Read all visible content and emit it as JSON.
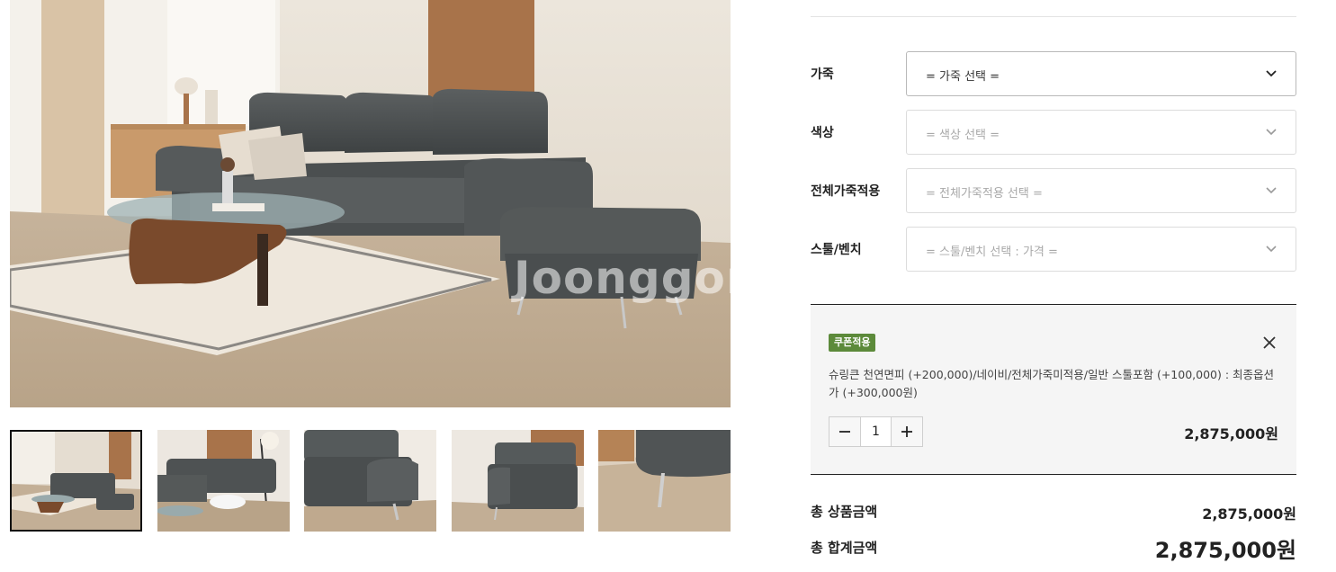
{
  "gallery": {
    "watermark": "Joonggon",
    "thumbnails": [
      {
        "name": "living-room-wide",
        "active": true
      },
      {
        "name": "sofa-with-lamp",
        "active": false
      },
      {
        "name": "sofa-arm-detail",
        "active": false
      },
      {
        "name": "loveseat-view",
        "active": false
      },
      {
        "name": "leg-detail",
        "active": false
      }
    ]
  },
  "options": [
    {
      "label": "가죽",
      "placeholder": "= 가죽 선택 =",
      "active": true
    },
    {
      "label": "색상",
      "placeholder": "= 색상 선택 =",
      "active": false
    },
    {
      "label": "전체가죽적용",
      "placeholder": "= 전체가죽적용 선택 =",
      "active": false
    },
    {
      "label": "스툴/벤치",
      "placeholder": "= 스툴/벤치 선택 : 가격 =",
      "active": false
    }
  ],
  "selected_item": {
    "badge": "쿠폰적용",
    "description": "슈링큰 천연면피 (+200,000)/네이비/전체가죽미적용/일반 스툴포함 (+100,000) : 최종옵션가 (+300,000원)",
    "quantity": "1",
    "price": "2,875,000원"
  },
  "totals": {
    "product_label": "총 상품금액",
    "product_value": "2,875,000원",
    "grand_label": "총 합계금액",
    "grand_value": "2,875,000원"
  },
  "colors": {
    "accent_badge": "#5c8a3a",
    "sofa": "#4e5253",
    "floor": "#c9b59c"
  }
}
